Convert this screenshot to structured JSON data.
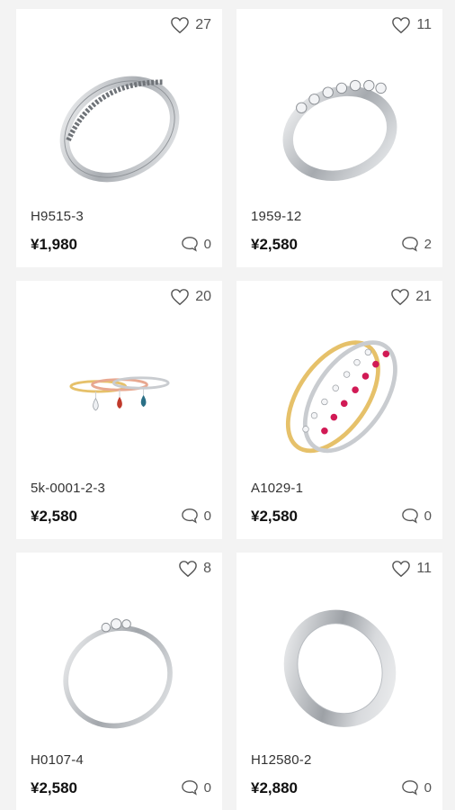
{
  "products": [
    {
      "code": "H9515-3",
      "price": "¥1,980",
      "likes": "27",
      "comments": "0",
      "image": "pave-band-ring"
    },
    {
      "code": "1959-12",
      "price": "¥2,580",
      "likes": "11",
      "comments": "2",
      "image": "half-eternity-ring"
    },
    {
      "code": "5k-0001-2-3",
      "price": "¥2,580",
      "likes": "20",
      "comments": "0",
      "image": "stacking-rings-with-drops"
    },
    {
      "code": "A1029-1",
      "price": "¥2,580",
      "likes": "21",
      "comments": "0",
      "image": "ruby-diamond-ring-set"
    },
    {
      "code": "H0107-4",
      "price": "¥2,580",
      "likes": "8",
      "comments": "0",
      "image": "three-stone-thin-ring"
    },
    {
      "code": "H12580-2",
      "price": "¥2,880",
      "likes": "11",
      "comments": "0",
      "image": "plain-silver-band"
    }
  ],
  "icons": {
    "like": "heart-outline-icon",
    "comment": "speech-bubble-icon"
  },
  "colors": {
    "page_bg": "#f3f3f3",
    "card_bg": "#ffffff",
    "silver": "#c9ccd0",
    "gold": "#e6c16a",
    "ruby": "#d11a55"
  }
}
